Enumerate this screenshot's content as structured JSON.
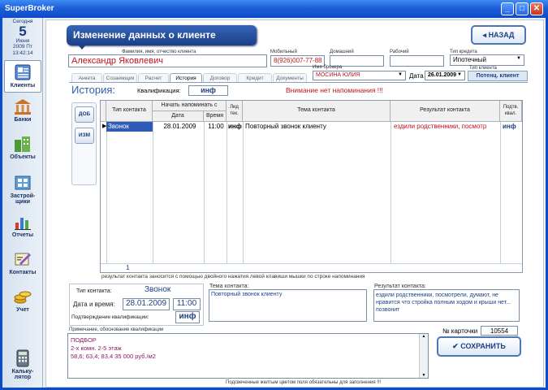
{
  "window": {
    "title": "SuperBroker"
  },
  "sidebar": {
    "today_label": "Сегодня",
    "day": "5",
    "month": "Июня",
    "year_weekday": "2009  Пт",
    "time": "13:42:14",
    "items": [
      {
        "label": "Клиенты",
        "icon": "clients-icon"
      },
      {
        "label": "Банки",
        "icon": "bank-icon"
      },
      {
        "label": "Объекты",
        "icon": "buildings-icon"
      },
      {
        "label": "Застрой-щики",
        "icon": "developers-icon"
      },
      {
        "label": "Отчеты",
        "icon": "reports-chart-icon"
      },
      {
        "label": "Контакты",
        "icon": "contacts-icon"
      },
      {
        "label": "Учет",
        "icon": "coins-icon"
      },
      {
        "label": "Кальку-лятор",
        "icon": "calculator-icon"
      }
    ]
  },
  "header": {
    "title": "Изменение данных о клиенте",
    "back_label": "НАЗАД"
  },
  "client": {
    "fio_label": "Фамилия, имя, отчество клиента",
    "fio": "Александр Яковлевич",
    "mobile_label": "Мобильный",
    "mobile": "8(926)007-77-88",
    "home_label": "Домашний",
    "home": "",
    "work_label": "Рабочий",
    "work": "",
    "credit_type_label": "Тип кредита",
    "credit_type": "Ипотечный",
    "broker_label": "Имя брокера",
    "broker": "МОСИНА ЮЛИЯ",
    "date_label": "Дата",
    "date": "26.01.2009",
    "client_type_label": "Тип клиента",
    "client_type": "Потенц. клиент"
  },
  "tabs": [
    "Анкета",
    "Созаемщик",
    "Расчет",
    "История",
    "Договор",
    "Кредит",
    "Документы"
  ],
  "history": {
    "title": "История:",
    "qualification_label": "Квалификация:",
    "qualification": "инф",
    "warning": "Внимание нет напоминания  !!!",
    "add_label": "ДОБ",
    "edit_label": "ИЗМ",
    "columns": {
      "type": "Тип контакта",
      "remind": "Начать напоминать с",
      "date": "Дата",
      "time": "Время",
      "lid": "Лид тек.",
      "topic": "Тема контакта",
      "result": "Результат контакта",
      "confirm": "Подтв. квал."
    },
    "rows": [
      {
        "type": "Звонок",
        "date": "28.01.2009",
        "time": "11:00",
        "lid": "инф",
        "topic": "Повторный звонок клиенту",
        "result": "ездили родственники, посмотр",
        "confirm": "инф"
      }
    ],
    "count": "1",
    "hint": "результат контакта  заносится с помощью двойного нажатия левой клавиши мышки по строке напоминания"
  },
  "detail": {
    "type_label": "Тип контакта:",
    "type": "Звонок",
    "datetime_label": "Дата и время:",
    "date": "28.01.2009",
    "time": "11:00",
    "confirm_label": "Подтверждение квалификации:",
    "confirm": "инф",
    "topic_label": "Тема контакта:",
    "topic": "Повторный звонок клиенту",
    "result_label": "Результат контакта:",
    "result": "ездили родственники, посмотрели, думают, не нравится что стройка полным ходом и крыши нет... позвонит"
  },
  "notes": {
    "label": "Примечание, обоснование квалификации",
    "lines": [
      "ПОДБОР",
      "2-х комн. 2-5 этаж",
      "58,6; 63,4; 83,4 35 000 руб./м2"
    ]
  },
  "card": {
    "label": "№ карточки",
    "number": "10554"
  },
  "save_label": "СОХРАНИТЬ",
  "footer_hint": "Подсвеченные желтым цветом поля  обязательны для заполнения !!!",
  "colors": {
    "title_bar": "#0c4bc9",
    "accent": "#1c3f86",
    "warning": "#c0141e",
    "selection": "#2f5bb7"
  }
}
